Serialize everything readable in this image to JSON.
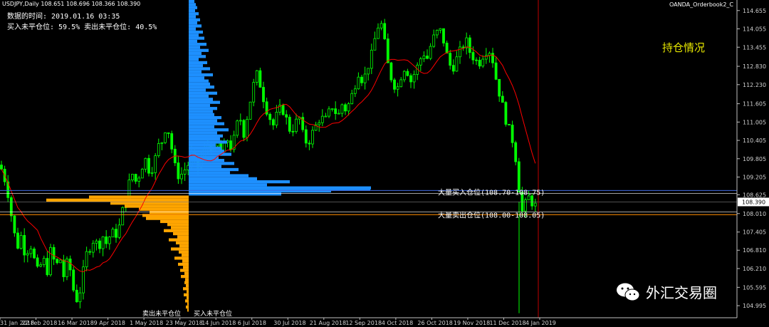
{
  "header": {
    "symbol_line": "USDJPY,Daily  108.651 108.696 108.366 108.390",
    "data_time": "数据的时间: 2019.01.16 03:35",
    "long_short": "买入未平仓位: 59.5%  卖出未平仓位: 40.5%",
    "indicator_name": "OANDA_Orderbook2_C"
  },
  "position_title": "持仓情况",
  "watermark": "外汇交易圈",
  "levels": {
    "buy_label": "大量买入仓位(108.70-108.75)",
    "sell_label": "大量卖出仓位(108.00-108.05)",
    "buy_price": 108.72,
    "sell_price": 108.02,
    "current_price": 108.39,
    "current_price_label": "108.390"
  },
  "profile_labels": {
    "sell_open": "卖出未平仓位",
    "buy_open": "买入未平仓位"
  },
  "colors": {
    "bull": "#00ff00",
    "bear": "#00ff00",
    "ma": "#ff0000",
    "buy_profile": "#1e90ff",
    "sell_profile": "#ffa500",
    "buy_line": "#4169e1",
    "sell_line": "#ff8c00",
    "vline": "#c00000"
  },
  "chart_data": {
    "type": "candlestick",
    "ylim": [
      104.6,
      115.0
    ],
    "y_ticks": [
      "114.655",
      "114.055",
      "113.455",
      "112.830",
      "112.230",
      "111.605",
      "111.005",
      "110.405",
      "109.805",
      "109.205",
      "108.625",
      "108.010",
      "107.405",
      "106.810",
      "106.210",
      "105.595",
      "104.995"
    ],
    "x_ticks": [
      "31 Jan 2018",
      "22 Feb 2018",
      "16 Mar 2018",
      "9 Apr 2018",
      "1 May 2018",
      "23 May 2018",
      "14 Jun 2018",
      "6 Jul 2018",
      "30 Jul 2018",
      "21 Aug 2018",
      "12 Sep 2018",
      "4 Oct 2018",
      "26 Oct 2018",
      "19 Nov 2018",
      "11 Dec 2018",
      "4 Jan 2019"
    ],
    "price_path": [
      [
        0,
        109.6
      ],
      [
        6,
        109.2
      ],
      [
        12,
        108.6
      ],
      [
        18,
        107.6
      ],
      [
        24,
        106.9
      ],
      [
        30,
        107.3
      ],
      [
        36,
        106.6
      ],
      [
        42,
        107.1
      ],
      [
        48,
        106.5
      ],
      [
        54,
        106.0
      ],
      [
        60,
        106.6
      ],
      [
        66,
        106.1
      ],
      [
        72,
        106.9
      ],
      [
        78,
        106.2
      ],
      [
        84,
        106.6
      ],
      [
        90,
        105.9
      ],
      [
        96,
        106.6
      ],
      [
        102,
        105.6
      ],
      [
        108,
        105.2
      ],
      [
        114,
        105.6
      ],
      [
        120,
        106.6
      ],
      [
        126,
        106.9
      ],
      [
        132,
        107.2
      ],
      [
        138,
        106.9
      ],
      [
        144,
        107.3
      ],
      [
        150,
        107.0
      ],
      [
        156,
        107.4
      ],
      [
        162,
        107.3
      ],
      [
        168,
        107.6
      ],
      [
        174,
        108.3
      ],
      [
        180,
        108.9
      ],
      [
        186,
        109.3
      ],
      [
        192,
        109.0
      ],
      [
        198,
        109.5
      ],
      [
        204,
        109.8
      ],
      [
        210,
        109.4
      ],
      [
        216,
        109.6
      ],
      [
        222,
        110.2
      ],
      [
        228,
        110.4
      ],
      [
        234,
        111.0
      ],
      [
        240,
        110.3
      ],
      [
        246,
        109.5
      ],
      [
        252,
        109.2
      ],
      [
        258,
        109.4
      ],
      [
        264,
        109.6
      ],
      [
        270,
        110.0
      ],
      [
        276,
        109.4
      ],
      [
        282,
        109.8
      ],
      [
        288,
        110.1
      ],
      [
        294,
        110.4
      ],
      [
        300,
        110.0
      ],
      [
        306,
        110.3
      ],
      [
        312,
        109.9
      ],
      [
        318,
        110.5
      ],
      [
        324,
        110.2
      ],
      [
        330,
        110.5
      ],
      [
        336,
        111.3
      ],
      [
        342,
        110.6
      ],
      [
        348,
        111.3
      ],
      [
        354,
        112.0
      ],
      [
        360,
        112.6
      ],
      [
        366,
        112.2
      ],
      [
        372,
        111.6
      ],
      [
        378,
        111.2
      ],
      [
        384,
        110.9
      ],
      [
        390,
        111.3
      ],
      [
        396,
        111.5
      ],
      [
        402,
        111.1
      ],
      [
        408,
        110.7
      ],
      [
        414,
        110.9
      ],
      [
        420,
        111.2
      ],
      [
        426,
        110.5
      ],
      [
        432,
        110.3
      ],
      [
        438,
        110.6
      ],
      [
        444,
        110.9
      ],
      [
        450,
        111.2
      ],
      [
        456,
        111.0
      ],
      [
        462,
        111.3
      ],
      [
        468,
        111.6
      ],
      [
        474,
        111.1
      ],
      [
        480,
        111.6
      ],
      [
        486,
        111.4
      ],
      [
        492,
        111.7
      ],
      [
        498,
        112.2
      ],
      [
        504,
        112.7
      ],
      [
        510,
        112.3
      ],
      [
        516,
        112.8
      ],
      [
        522,
        113.2
      ],
      [
        528,
        113.9
      ],
      [
        534,
        114.4
      ],
      [
        540,
        113.6
      ],
      [
        546,
        112.7
      ],
      [
        552,
        112.3
      ],
      [
        558,
        112.1
      ],
      [
        564,
        112.6
      ],
      [
        570,
        112.9
      ],
      [
        576,
        112.3
      ],
      [
        582,
        112.6
      ],
      [
        588,
        112.9
      ],
      [
        594,
        113.3
      ],
      [
        600,
        113.1
      ],
      [
        606,
        113.6
      ],
      [
        612,
        113.9
      ],
      [
        618,
        114.0
      ],
      [
        624,
        113.6
      ],
      [
        630,
        112.9
      ],
      [
        636,
        112.8
      ],
      [
        642,
        113.1
      ],
      [
        648,
        113.4
      ],
      [
        654,
        113.7
      ],
      [
        660,
        113.3
      ],
      [
        666,
        113.1
      ],
      [
        672,
        112.9
      ],
      [
        678,
        113.2
      ],
      [
        684,
        113.4
      ],
      [
        690,
        113.3
      ],
      [
        696,
        112.5
      ],
      [
        702,
        111.9
      ],
      [
        708,
        111.3
      ],
      [
        714,
        110.8
      ],
      [
        720,
        110.4
      ],
      [
        726,
        109.6
      ],
      [
        732,
        108.0
      ],
      [
        738,
        108.3
      ],
      [
        744,
        108.6
      ],
      [
        750,
        108.2
      ],
      [
        756,
        108.4
      ]
    ],
    "sell_profile_rows": [
      [
        108.55,
        140
      ],
      [
        108.45,
        200
      ],
      [
        108.35,
        110
      ],
      [
        108.25,
        90
      ],
      [
        108.15,
        70
      ],
      [
        108.05,
        55
      ],
      [
        107.95,
        65
      ],
      [
        107.85,
        60
      ],
      [
        107.75,
        40
      ],
      [
        107.65,
        30
      ],
      [
        107.55,
        25
      ],
      [
        107.45,
        35
      ],
      [
        107.35,
        22
      ],
      [
        107.25,
        16
      ],
      [
        107.15,
        28
      ],
      [
        107.05,
        18
      ],
      [
        106.95,
        13
      ],
      [
        106.85,
        25
      ],
      [
        106.75,
        14
      ],
      [
        106.65,
        10
      ],
      [
        106.55,
        20
      ],
      [
        106.45,
        9
      ],
      [
        106.35,
        15
      ],
      [
        106.25,
        8
      ],
      [
        106.15,
        12
      ],
      [
        106.05,
        6
      ],
      [
        105.95,
        11
      ],
      [
        105.85,
        5
      ],
      [
        105.75,
        6
      ],
      [
        105.65,
        4
      ],
      [
        105.55,
        8
      ],
      [
        105.45,
        3
      ],
      [
        105.35,
        7
      ],
      [
        105.25,
        3
      ],
      [
        105.15,
        5
      ],
      [
        105.05,
        2
      ],
      [
        104.95,
        4
      ],
      [
        104.85,
        2
      ]
    ],
    "buy_profile_rows": [
      [
        114.95,
        8
      ],
      [
        114.85,
        10
      ],
      [
        114.75,
        12
      ],
      [
        114.65,
        9
      ],
      [
        114.55,
        14
      ],
      [
        114.45,
        10
      ],
      [
        114.35,
        16
      ],
      [
        114.25,
        12
      ],
      [
        114.15,
        18
      ],
      [
        114.05,
        10
      ],
      [
        113.95,
        20
      ],
      [
        113.85,
        14
      ],
      [
        113.75,
        22
      ],
      [
        113.65,
        12
      ],
      [
        113.55,
        25
      ],
      [
        113.45,
        16
      ],
      [
        113.35,
        28
      ],
      [
        113.25,
        18
      ],
      [
        113.15,
        24
      ],
      [
        113.05,
        14
      ],
      [
        112.95,
        26
      ],
      [
        112.85,
        20
      ],
      [
        112.75,
        30
      ],
      [
        112.65,
        18
      ],
      [
        112.55,
        34
      ],
      [
        112.45,
        22
      ],
      [
        112.35,
        28
      ],
      [
        112.25,
        30
      ],
      [
        112.15,
        36
      ],
      [
        112.05,
        24
      ],
      [
        111.95,
        40
      ],
      [
        111.85,
        28
      ],
      [
        111.75,
        34
      ],
      [
        111.65,
        44
      ],
      [
        111.55,
        30
      ],
      [
        111.45,
        40
      ],
      [
        111.35,
        34
      ],
      [
        111.25,
        36
      ],
      [
        111.15,
        46
      ],
      [
        111.05,
        40
      ],
      [
        110.95,
        50
      ],
      [
        110.85,
        36
      ],
      [
        110.75,
        56
      ],
      [
        110.65,
        40
      ],
      [
        110.55,
        48
      ],
      [
        110.45,
        44
      ],
      [
        110.35,
        54
      ],
      [
        110.25,
        38
      ],
      [
        110.15,
        46
      ],
      [
        110.05,
        50
      ],
      [
        109.95,
        60
      ],
      [
        109.85,
        42
      ],
      [
        109.75,
        50
      ],
      [
        109.65,
        64
      ],
      [
        109.55,
        46
      ],
      [
        109.45,
        70
      ],
      [
        109.35,
        58
      ],
      [
        109.25,
        84
      ],
      [
        109.15,
        96
      ],
      [
        109.05,
        142
      ],
      [
        108.95,
        110
      ],
      [
        108.85,
        256
      ],
      [
        108.75,
        200
      ],
      [
        108.65,
        130
      ]
    ]
  }
}
